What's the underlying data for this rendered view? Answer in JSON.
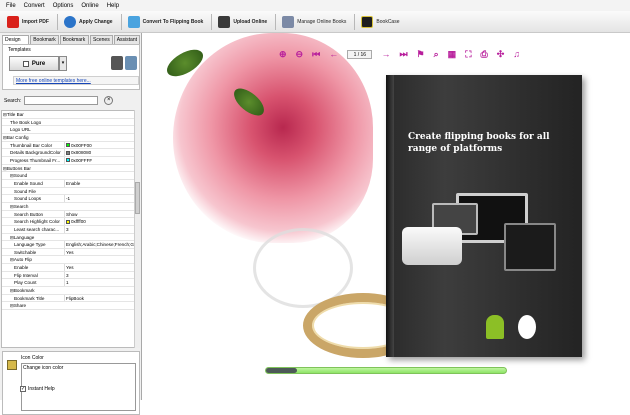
{
  "menu": [
    "File",
    "Convert",
    "Options",
    "Online",
    "Help"
  ],
  "toolbar": {
    "import_pdf": "Import PDF",
    "apply_change": "Apply Change",
    "convert": "Convert To Flipping Book",
    "upload": "Upload Online",
    "manage": "Manage Online Books",
    "bookcase": "BookCase"
  },
  "tabs": [
    "Design Setting",
    "Bookmark",
    "Bookmark Table",
    "Scenes",
    "Assistant"
  ],
  "templates": {
    "label": "Templates",
    "selected": "Pure",
    "more_link": "More free online templates here..."
  },
  "search": {
    "label": "Search:",
    "value": ""
  },
  "properties": [
    {
      "key": "⊟Title Bar",
      "value": "",
      "level": 0
    },
    {
      "key": "The Book Logo",
      "value": "",
      "level": 1
    },
    {
      "key": "Logo URL",
      "value": "",
      "level": 1
    },
    {
      "key": "⊟Bar Config",
      "value": "",
      "level": 0
    },
    {
      "key": "Thumbnail Bar Color",
      "value": "0x00FF00",
      "level": 1,
      "swatch": "#00ff00"
    },
    {
      "key": "Details BackgroundColor",
      "value": "0x808080",
      "level": 1,
      "swatch": "#808080"
    },
    {
      "key": "Progress Thumbnail Fr...",
      "value": "0x00FFFF",
      "level": 1,
      "swatch": "#00ffff"
    },
    {
      "key": "⊟Buttons Bar",
      "value": "",
      "level": 0
    },
    {
      "key": "⊟Sound",
      "value": "",
      "level": 1
    },
    {
      "key": "Enable Sound",
      "value": "Enable",
      "level": 2
    },
    {
      "key": "Sound File",
      "value": "",
      "level": 2
    },
    {
      "key": "Sound Loops",
      "value": "-1",
      "level": 2
    },
    {
      "key": "⊟Search",
      "value": "",
      "level": 1
    },
    {
      "key": "Search Button",
      "value": "Show",
      "level": 2
    },
    {
      "key": "Search Highlight Color",
      "value": "0xffff00",
      "level": 2,
      "swatch": "#ffff00"
    },
    {
      "key": "Least search charac...",
      "value": "3",
      "level": 2
    },
    {
      "key": "⊟Language",
      "value": "",
      "level": 1
    },
    {
      "key": "Language Type",
      "value": "English;Arabic;Chinese;French;Ger...",
      "level": 2
    },
    {
      "key": "Switchable",
      "value": "Yes",
      "level": 2
    },
    {
      "key": "⊟Auto Flip",
      "value": "",
      "level": 1
    },
    {
      "key": "Enable",
      "value": "Yes",
      "level": 2
    },
    {
      "key": "Flip Interval",
      "value": "3",
      "level": 2
    },
    {
      "key": "Play Count",
      "value": "1",
      "level": 2
    },
    {
      "key": "⊟Bookmark",
      "value": "",
      "level": 1
    },
    {
      "key": "Bookmark Title",
      "value": "FlipBook",
      "level": 2
    },
    {
      "key": "⊟Share",
      "value": "",
      "level": 1
    }
  ],
  "help": {
    "title": "Icon Color",
    "description": "Change icon color",
    "instant_help": "Instant Help"
  },
  "viewer": {
    "page_indicator": "1 / 16",
    "cover_title": "Create flipping books for all range of platforms",
    "accent_color": "#b81f9c",
    "progress": 0.13
  }
}
